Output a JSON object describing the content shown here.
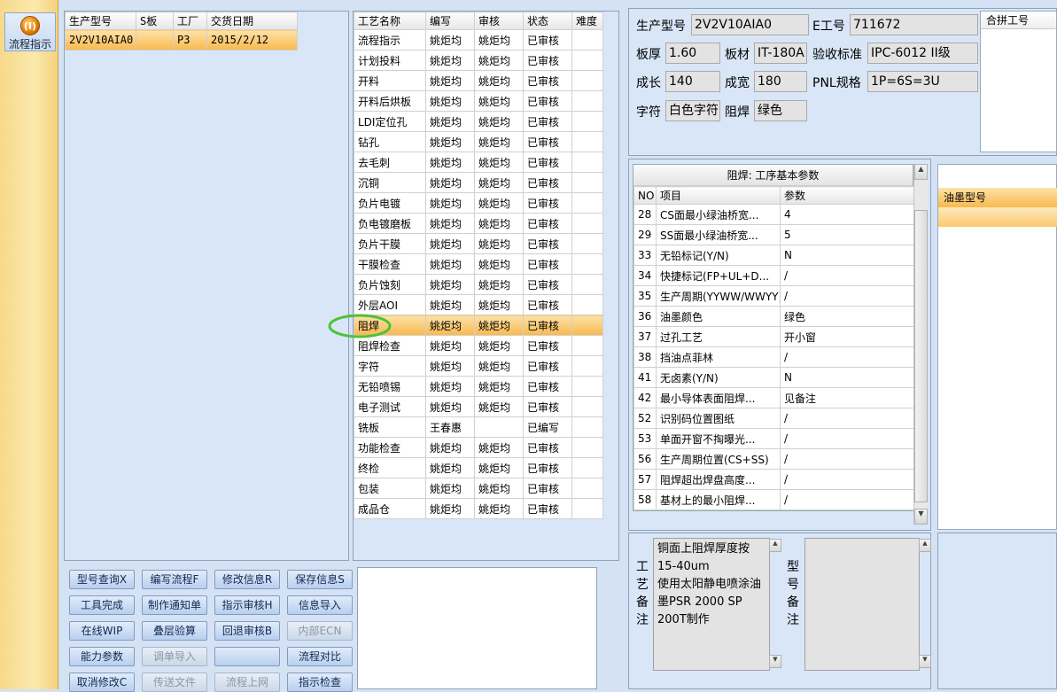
{
  "sidebar": {
    "flow_button_label": "流程指示",
    "flow_icon_text": "(I)"
  },
  "orders": {
    "headers": [
      "生产型号",
      "S板",
      "工厂",
      "交货日期"
    ],
    "rows": [
      [
        "2V2V10AIA0",
        "",
        "P3",
        "2015/2/12"
      ]
    ]
  },
  "steps": {
    "headers": [
      "工艺名称",
      "编写",
      "审核",
      "状态",
      "难度"
    ],
    "rows": [
      [
        "流程指示",
        "姚炬均",
        "姚炬均",
        "已审核",
        ""
      ],
      [
        "计划投料",
        "姚炬均",
        "姚炬均",
        "已审核",
        ""
      ],
      [
        "开料",
        "姚炬均",
        "姚炬均",
        "已审核",
        ""
      ],
      [
        "开料后烘板",
        "姚炬均",
        "姚炬均",
        "已审核",
        ""
      ],
      [
        "LDI定位孔",
        "姚炬均",
        "姚炬均",
        "已审核",
        ""
      ],
      [
        "钻孔",
        "姚炬均",
        "姚炬均",
        "已审核",
        ""
      ],
      [
        "去毛刺",
        "姚炬均",
        "姚炬均",
        "已审核",
        ""
      ],
      [
        "沉铜",
        "姚炬均",
        "姚炬均",
        "已审核",
        ""
      ],
      [
        "负片电镀",
        "姚炬均",
        "姚炬均",
        "已审核",
        ""
      ],
      [
        "负电镀磨板",
        "姚炬均",
        "姚炬均",
        "已审核",
        ""
      ],
      [
        "负片干膜",
        "姚炬均",
        "姚炬均",
        "已审核",
        ""
      ],
      [
        "干膜检查",
        "姚炬均",
        "姚炬均",
        "已审核",
        ""
      ],
      [
        "负片蚀刻",
        "姚炬均",
        "姚炬均",
        "已审核",
        ""
      ],
      [
        "外层AOI",
        "姚炬均",
        "姚炬均",
        "已审核",
        ""
      ],
      [
        "阻焊",
        "姚炬均",
        "姚炬均",
        "已审核",
        ""
      ],
      [
        "阻焊检查",
        "姚炬均",
        "姚炬均",
        "已审核",
        ""
      ],
      [
        "字符",
        "姚炬均",
        "姚炬均",
        "已审核",
        ""
      ],
      [
        "无铅喷锡",
        "姚炬均",
        "姚炬均",
        "已审核",
        ""
      ],
      [
        "电子测试",
        "姚炬均",
        "姚炬均",
        "已审核",
        ""
      ],
      [
        "铣板",
        "王春惠",
        "",
        "已编写",
        ""
      ],
      [
        "功能检查",
        "姚炬均",
        "姚炬均",
        "已审核",
        ""
      ],
      [
        "终检",
        "姚炬均",
        "姚炬均",
        "已审核",
        ""
      ],
      [
        "包装",
        "姚炬均",
        "姚炬均",
        "已审核",
        ""
      ],
      [
        "成品仓",
        "姚炬均",
        "姚炬均",
        "已审核",
        ""
      ]
    ],
    "selected_index": 14
  },
  "buttons": [
    [
      "型号查询X",
      "编写流程F",
      "修改信息R",
      "保存信息S"
    ],
    [
      "工具完成",
      "制作通知单",
      "指示审核H",
      "信息导入"
    ],
    [
      "在线WIP",
      "叠层验算",
      "回退审核B",
      "内部ECN"
    ],
    [
      "能力参数",
      "调单导入",
      "",
      "流程对比"
    ],
    [
      "取消修改C",
      "传送文件",
      "流程上网",
      "指示检查"
    ]
  ],
  "disabled_buttons": [
    "内部ECN",
    "调单导入",
    "传送文件",
    "流程上网"
  ],
  "info": {
    "model_label": "生产型号",
    "model_value": "2V2V10AIA0",
    "eno_label": "E工号",
    "eno_value": "711672",
    "merge_label": "合拼工号",
    "thickness_label": "板厚",
    "thickness_value": "1.60",
    "material_label": "板材",
    "material_value": "IT-180A",
    "standard_label": "验收标准",
    "standard_value": "IPC-6012 II级",
    "length_label": "成长",
    "length_value": "140",
    "width_label": "成宽",
    "width_value": "180",
    "pnl_label": "PNL规格",
    "pnl_value": "1P=6S=3U",
    "char_label": "字符",
    "char_value": "白色字符",
    "mask_label": "阻焊",
    "mask_value": "绿色"
  },
  "params": {
    "caption": "阻焊: 工序基本参数",
    "headers": [
      "NO",
      "项目",
      "参数"
    ],
    "rows": [
      [
        "28",
        "CS面最小绿油桥宽...",
        "4"
      ],
      [
        "29",
        "SS面最小绿油桥宽...",
        "5"
      ],
      [
        "33",
        "无铅标记(Y/N)",
        "N"
      ],
      [
        "34",
        "快捷标记(FP+UL+D...",
        "/"
      ],
      [
        "35",
        "生产周期(YYWW/WWYY)",
        "/"
      ],
      [
        "36",
        "油墨颜色",
        "绿色"
      ],
      [
        "37",
        "过孔工艺",
        "开小窗"
      ],
      [
        "38",
        "挡油点菲林",
        "/"
      ],
      [
        "41",
        "无卤素(Y/N)",
        "N"
      ],
      [
        "42",
        "最小导体表面阻焊...",
        "见备注"
      ],
      [
        "52",
        "识别码位置图纸",
        "/"
      ],
      [
        "53",
        "单面开窗不掏曝光...",
        "/"
      ],
      [
        "56",
        "生产周期位置(CS+SS)",
        "/"
      ],
      [
        "57",
        "阻焊超出焊盘高度...",
        "/"
      ],
      [
        "58",
        "基材上的最小阻焊...",
        "/"
      ]
    ]
  },
  "ink": {
    "header": "油墨型号"
  },
  "notes": {
    "process_label": "工艺备注",
    "process_text": "铜面上阻焊厚度按15-40um\n使用太阳静电喷涂油墨PSR 2000 SP 200T制作",
    "model_label": "型号备注",
    "model_text": ""
  },
  "colors": {
    "accent": "#f8b94f",
    "highlight_ring": "#4cc23a"
  }
}
